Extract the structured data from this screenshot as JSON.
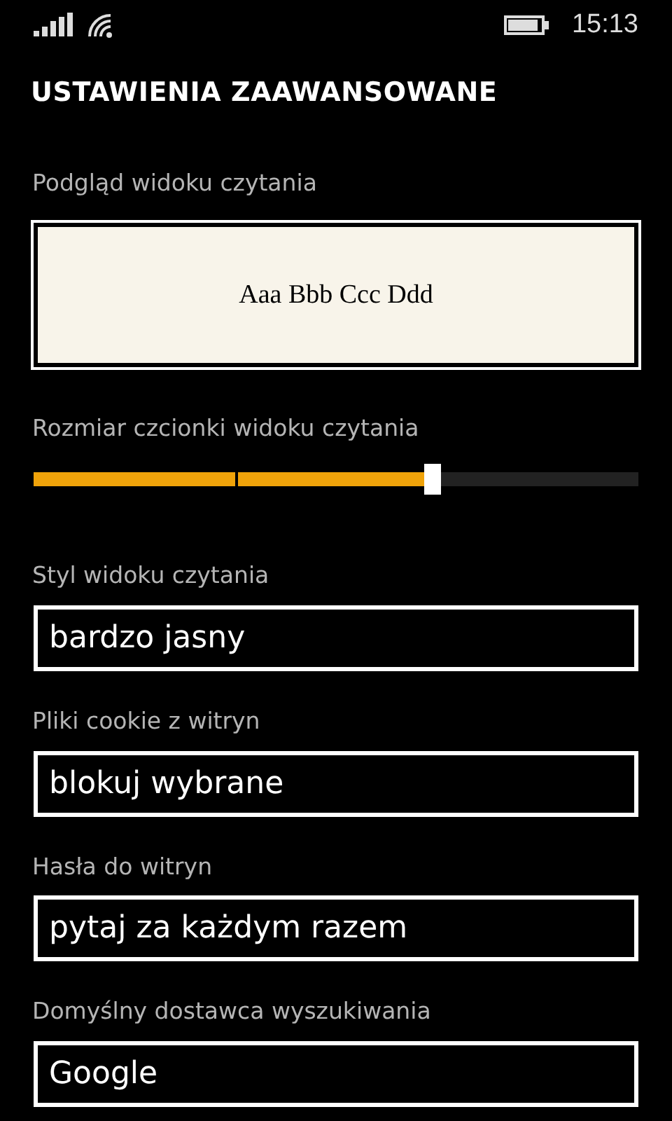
{
  "status_bar": {
    "time": "15:13"
  },
  "title": "USTAWIENIA ZAAWANSOWANE",
  "preview": {
    "label": "Podgląd widoku czytania",
    "sample": "Aaa Bbb Ccc Ddd"
  },
  "font_size": {
    "label": "Rozmiar czcionki widoku czytania",
    "level": 0.66
  },
  "settings": [
    {
      "label": "Styl widoku czytania",
      "value": "bardzo jasny"
    },
    {
      "label": "Pliki cookie z witryn",
      "value": "blokuj wybrane"
    },
    {
      "label": "Hasła do witryn",
      "value": "pytaj za każdym razem"
    },
    {
      "label": "Domyślny dostawca wyszukiwania",
      "value": "Google"
    }
  ]
}
